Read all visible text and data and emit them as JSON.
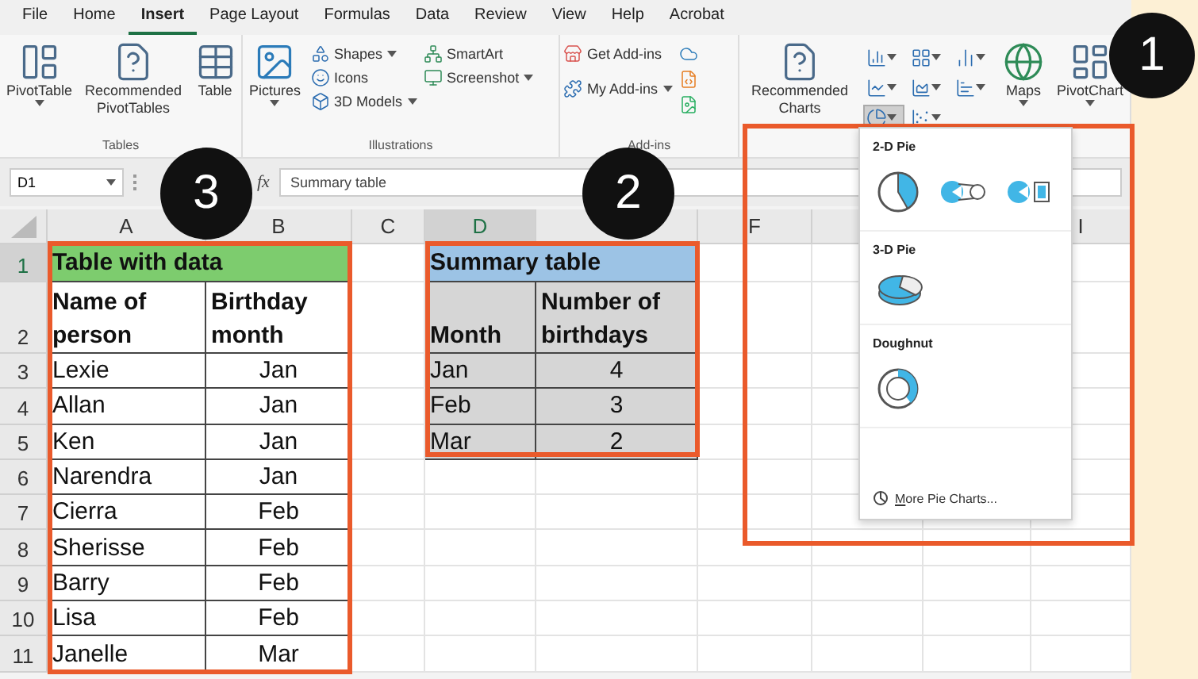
{
  "menu_tabs": [
    {
      "label": "File",
      "selected": false
    },
    {
      "label": "Home",
      "selected": false
    },
    {
      "label": "Insert",
      "selected": true
    },
    {
      "label": "Page Layout",
      "selected": false
    },
    {
      "label": "Formulas",
      "selected": false
    },
    {
      "label": "Data",
      "selected": false
    },
    {
      "label": "Review",
      "selected": false
    },
    {
      "label": "View",
      "selected": false
    },
    {
      "label": "Help",
      "selected": false
    },
    {
      "label": "Acrobat",
      "selected": false
    }
  ],
  "ribbon": {
    "tables": {
      "label": "Tables",
      "buttons": [
        {
          "label": "PivotTable",
          "menu": true
        },
        {
          "label": "Recommended PivotTables",
          "menu": false
        },
        {
          "label": "Table",
          "menu": false
        }
      ]
    },
    "illustrations": {
      "label": "Illustrations",
      "pictures": {
        "label": "Pictures",
        "menu": true
      },
      "small_buttons": [
        {
          "label": "Shapes",
          "menu": true
        },
        {
          "label": "Icons",
          "menu": false
        },
        {
          "label": "3D Models",
          "menu": true
        },
        {
          "label": "SmartArt",
          "menu": false
        },
        {
          "label": "Screenshot",
          "menu": true
        }
      ]
    },
    "add_ins": {
      "label": "Add-ins",
      "buttons": [
        {
          "label": "Get Add-ins",
          "menu": false
        },
        {
          "label": "My Add-ins",
          "menu": true
        }
      ]
    },
    "charts": {
      "recommended": "Recommended Charts",
      "chart_buttons": [
        {
          "selected": false
        },
        {
          "selected": false
        },
        {
          "selected": false
        },
        {
          "selected": false
        },
        {
          "selected": false
        },
        {
          "selected": false
        },
        {
          "selected": true
        },
        {
          "selected": false
        }
      ],
      "large_buttons": [
        {
          "label": "Maps",
          "menu": true
        },
        {
          "label": "PivotChart",
          "menu": true
        }
      ]
    }
  },
  "formula_bar": {
    "name_box": "D1",
    "function_label": "fx",
    "value": "Summary table"
  },
  "sheet": {
    "columns": [
      {
        "label": "A",
        "selected": false
      },
      {
        "label": "B",
        "selected": false
      },
      {
        "label": "C",
        "selected": false
      },
      {
        "label": "D",
        "selected": true
      },
      {},
      {
        "label": "F",
        "selected": false
      },
      {},
      {},
      {
        "label": "I",
        "selected": false
      }
    ],
    "rows": [
      {
        "label": "1",
        "selected": true
      },
      {
        "label": "2",
        "selected": false
      },
      {
        "label": "3",
        "selected": false
      },
      {
        "label": "4",
        "selected": false
      },
      {
        "label": "5",
        "selected": false
      },
      {
        "label": "6",
        "selected": false
      },
      {
        "label": "7",
        "selected": false
      },
      {
        "label": "8",
        "selected": false
      },
      {
        "label": "9",
        "selected": false
      },
      {
        "label": "10",
        "selected": false
      },
      {
        "label": "11",
        "selected": false
      }
    ],
    "table_with_data": {
      "title": "Table with data",
      "headers": [
        "Name of person",
        "Birthday month"
      ],
      "rows": [
        [
          "Lexie",
          "Jan"
        ],
        [
          "Allan",
          "Jan"
        ],
        [
          "Ken",
          "Jan"
        ],
        [
          "Narendra",
          "Jan"
        ],
        [
          "Cierra",
          "Feb"
        ],
        [
          "Sherisse",
          "Feb"
        ],
        [
          "Barry",
          "Feb"
        ],
        [
          "Lisa",
          "Feb"
        ],
        [
          "Janelle",
          "Mar"
        ]
      ]
    },
    "summary_table": {
      "title": "Summary table",
      "headers": [
        "Month",
        "Number of birthdays"
      ],
      "rows": [
        [
          "Jan",
          "4"
        ],
        [
          "Feb",
          "3"
        ],
        [
          "Mar",
          "2"
        ]
      ]
    }
  },
  "pie_menu": {
    "sections": [
      {
        "title": "2-D Pie"
      },
      {
        "title": "3-D Pie"
      },
      {
        "title": "Doughnut"
      }
    ],
    "footer": "More Pie Charts..."
  },
  "callouts": [
    {
      "number": "1"
    },
    {
      "number": "2"
    },
    {
      "number": "3"
    }
  ]
}
